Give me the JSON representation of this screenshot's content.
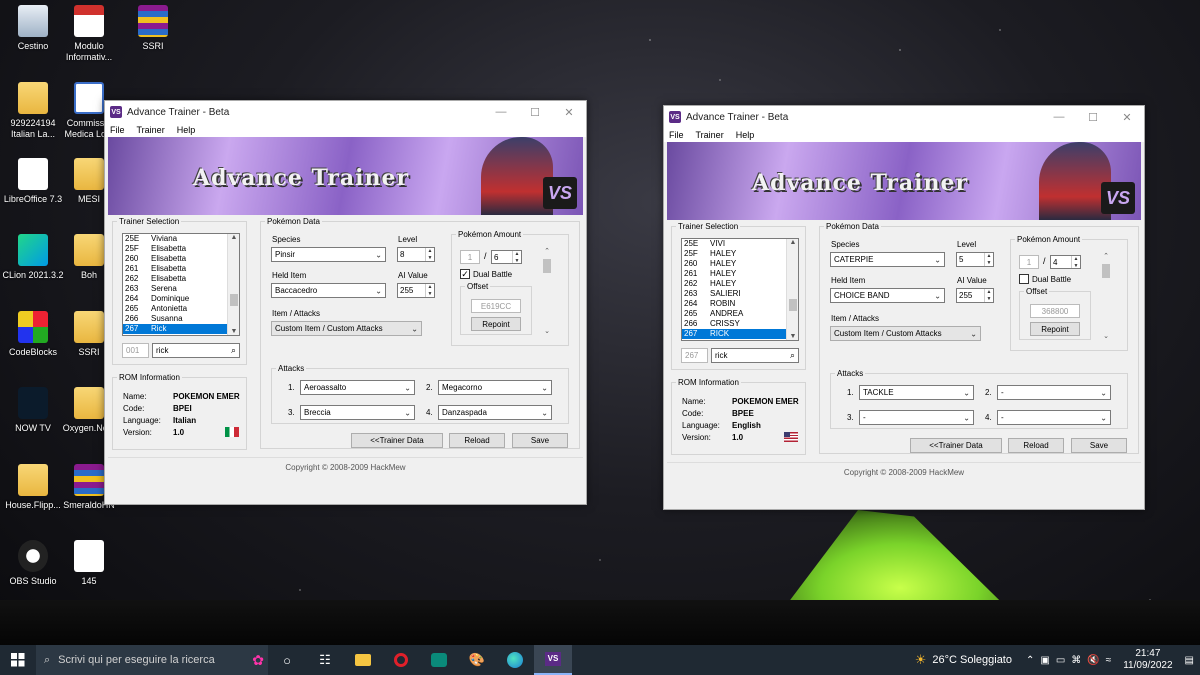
{
  "desktop": {
    "icons": [
      {
        "label": "Cestino",
        "icon": "recycle-bin-icon"
      },
      {
        "label": "Modulo Informativ...",
        "icon": "pdf-icon"
      },
      {
        "label": "SSRI",
        "icon": "winrar-archive-icon"
      },
      {
        "label": "929224194 Italian La...",
        "icon": "folder-file-icon"
      },
      {
        "label": "Commissio Medica Lo...",
        "icon": "document-icon"
      },
      {
        "label": "LibreOffice 7.3",
        "icon": "libreoffice-icon"
      },
      {
        "label": "MESI",
        "icon": "folder-icon"
      },
      {
        "label": "CLion 2021.3.2",
        "icon": "clion-icon"
      },
      {
        "label": "Boh",
        "icon": "folder-icon"
      },
      {
        "label": "CodeBlocks",
        "icon": "codeblocks-icon"
      },
      {
        "label": "SSRI",
        "icon": "folder-icon"
      },
      {
        "label": "NOW TV",
        "icon": "nowtv-icon"
      },
      {
        "label": "Oxygen.No...",
        "icon": "folder-file-icon"
      },
      {
        "label": "House.Flipp...",
        "icon": "folder-file-icon"
      },
      {
        "label": "SmeraldoHN",
        "icon": "winrar-archive-icon"
      },
      {
        "label": "OBS Studio",
        "icon": "obs-icon"
      },
      {
        "label": "145",
        "icon": "settings-file-icon"
      }
    ]
  },
  "windows": [
    {
      "title": "Advance Trainer - Beta",
      "menu": [
        "File",
        "Trainer",
        "Help"
      ],
      "banner": "Advance Trainer",
      "banner_badge": "VS",
      "trainer_selection": {
        "legend": "Trainer Selection",
        "rows": [
          [
            "25E",
            "Viviana"
          ],
          [
            "25F",
            "Elisabetta"
          ],
          [
            "260",
            "Elisabetta"
          ],
          [
            "261",
            "Elisabetta"
          ],
          [
            "262",
            "Elisabetta"
          ],
          [
            "263",
            "Serena"
          ],
          [
            "264",
            "Dominique"
          ],
          [
            "265",
            "Antonietta"
          ],
          [
            "266",
            "Susanna"
          ],
          [
            "267",
            "Rick"
          ]
        ],
        "selected_index": 9,
        "id_field": "001",
        "search_field": "rick"
      },
      "rom": {
        "legend": "ROM Information",
        "name_label": "Name:",
        "name": "POKEMON EMER",
        "code_label": "Code:",
        "code": "BPEI",
        "lang_label": "Language:",
        "lang": "Italian",
        "ver_label": "Version:",
        "ver": "1.0",
        "flag": "italy-flag-icon"
      },
      "pokemon": {
        "legend": "Pokémon Data",
        "species_label": "Species",
        "species": "Pinsir",
        "level_label": "Level",
        "level": "8",
        "held_label": "Held Item",
        "held": "Baccacedro",
        "ai_label": "AI Value",
        "ai": "255",
        "ia_label": "Item / Attacks",
        "ia": "Custom Item / Custom Attacks"
      },
      "amount": {
        "legend": "Pokémon Amount",
        "current": "1",
        "sep": "/",
        "total": "6",
        "dual_label": "Dual Battle",
        "dual": true,
        "offset_legend": "Offset",
        "offset": "E619CC",
        "repoint": "Repoint"
      },
      "attacks": {
        "legend": "Attacks",
        "list": [
          {
            "n": "1.",
            "v": "Aeroassalto"
          },
          {
            "n": "2.",
            "v": "Megacorno"
          },
          {
            "n": "3.",
            "v": "Breccia"
          },
          {
            "n": "4.",
            "v": "Danzaspada"
          }
        ]
      },
      "buttons": {
        "trainer_data": "<<Trainer Data",
        "reload": "Reload",
        "save": "Save"
      },
      "copyright": "Copyright © 2008-2009 HackMew"
    },
    {
      "title": "Advance Trainer - Beta",
      "menu": [
        "File",
        "Trainer",
        "Help"
      ],
      "banner": "Advance Trainer",
      "banner_badge": "VS",
      "trainer_selection": {
        "legend": "Trainer Selection",
        "rows": [
          [
            "25E",
            "VIVI"
          ],
          [
            "25F",
            "HALEY"
          ],
          [
            "260",
            "HALEY"
          ],
          [
            "261",
            "HALEY"
          ],
          [
            "262",
            "HALEY"
          ],
          [
            "263",
            "SALIERI"
          ],
          [
            "264",
            "ROBIN"
          ],
          [
            "265",
            "ANDREA"
          ],
          [
            "266",
            "CRISSY"
          ],
          [
            "267",
            "RICK"
          ]
        ],
        "selected_index": 9,
        "id_field": "267",
        "search_field": "rick"
      },
      "rom": {
        "legend": "ROM Information",
        "name_label": "Name:",
        "name": "POKEMON EMER",
        "code_label": "Code:",
        "code": "BPEE",
        "lang_label": "Language:",
        "lang": "English",
        "ver_label": "Version:",
        "ver": "1.0",
        "flag": "usa-flag-icon"
      },
      "pokemon": {
        "legend": "Pokémon Data",
        "species_label": "Species",
        "species": "CATERPIE",
        "level_label": "Level",
        "level": "5",
        "held_label": "Held Item",
        "held": "CHOICE BAND",
        "ai_label": "AI Value",
        "ai": "255",
        "ia_label": "Item / Attacks",
        "ia": "Custom Item / Custom Attacks"
      },
      "amount": {
        "legend": "Pokémon Amount",
        "current": "1",
        "sep": "/",
        "total": "4",
        "dual_label": "Dual Battle",
        "dual": false,
        "offset_legend": "Offset",
        "offset": "368800",
        "repoint": "Repoint"
      },
      "attacks": {
        "legend": "Attacks",
        "list": [
          {
            "n": "1.",
            "v": "TACKLE"
          },
          {
            "n": "2.",
            "v": "-"
          },
          {
            "n": "3.",
            "v": "-"
          },
          {
            "n": "4.",
            "v": "-"
          }
        ]
      },
      "buttons": {
        "trainer_data": "<<Trainer Data",
        "reload": "Reload",
        "save": "Save"
      },
      "copyright": "Copyright © 2008-2009 HackMew"
    }
  ],
  "taskbar": {
    "search_placeholder": "Scrivi qui per eseguire la ricerca",
    "apps": [
      "task-view-icon",
      "file-explorer-icon",
      "opera-icon",
      "nowtv-icon",
      "paint-icon",
      "edge-icon",
      "advance-trainer-icon"
    ],
    "weather": "26°C Soleggiato",
    "time": "21:47",
    "date": "11/09/2022"
  }
}
